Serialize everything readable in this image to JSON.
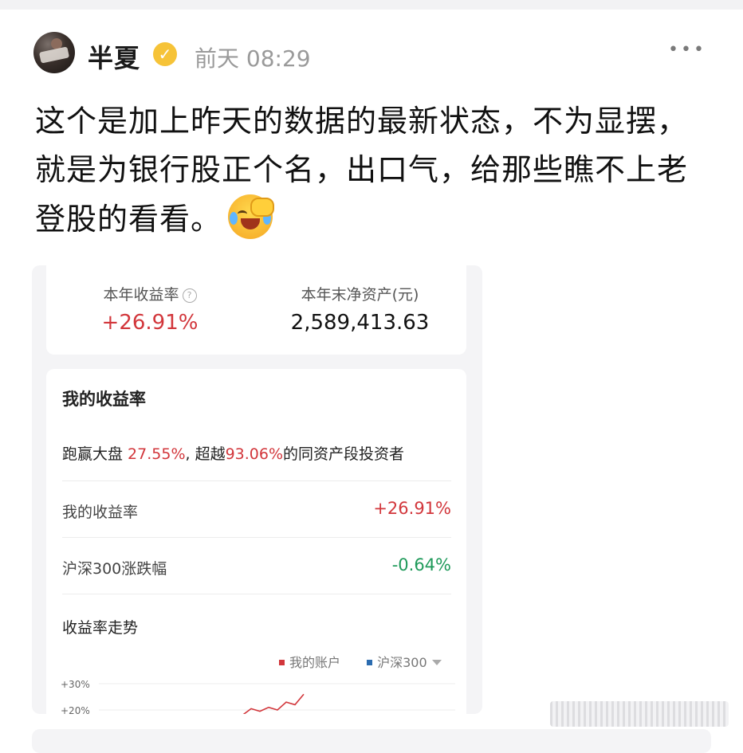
{
  "post": {
    "username": "半夏",
    "verify_badge": "✓",
    "time": "前天 08:29",
    "more": "•••",
    "text": "这个是加上昨天的数据的最新状态，不为显摆，就是为银行股正个名，出口气，给那些瞧不上老登股的看看。",
    "emoji_icon": "laughing-crying-facepalm-icon"
  },
  "screenshot": {
    "ytd_return_label": "本年收益率",
    "ytd_return_value": "+26.91%",
    "net_assets_label": "本年末净资产(元)",
    "net_assets_value": "2,589,413.63",
    "section_title": "我的收益率",
    "compare": {
      "prefix": "跑赢大盘 ",
      "beat_value": "27.55%",
      "mid": ", 超越",
      "exceed_value": "93.06%",
      "suffix": "的同资产段投资者"
    },
    "rows": [
      {
        "label": "我的收益率",
        "value": "+26.91%"
      },
      {
        "label": "沪深300涨跌幅",
        "value": "-0.64%"
      }
    ],
    "trend_title": "收益率走势",
    "legend": {
      "my_account": "我的账户",
      "index": "沪深300"
    },
    "colors": {
      "positive": "#d2363b",
      "negative": "#1f9a5a",
      "index_series": "#2b6cb0"
    }
  },
  "chart_data": {
    "type": "line",
    "y_tick_labels": [
      "+30%",
      "+20%"
    ],
    "ylim": [
      20,
      30
    ],
    "series": [
      {
        "name": "我的账户",
        "x": [
          0,
          1,
          2,
          3,
          4,
          5,
          6,
          7
        ],
        "values": [
          18,
          20.5,
          19.5,
          21,
          20,
          23,
          22,
          26
        ]
      }
    ],
    "grid": true
  }
}
